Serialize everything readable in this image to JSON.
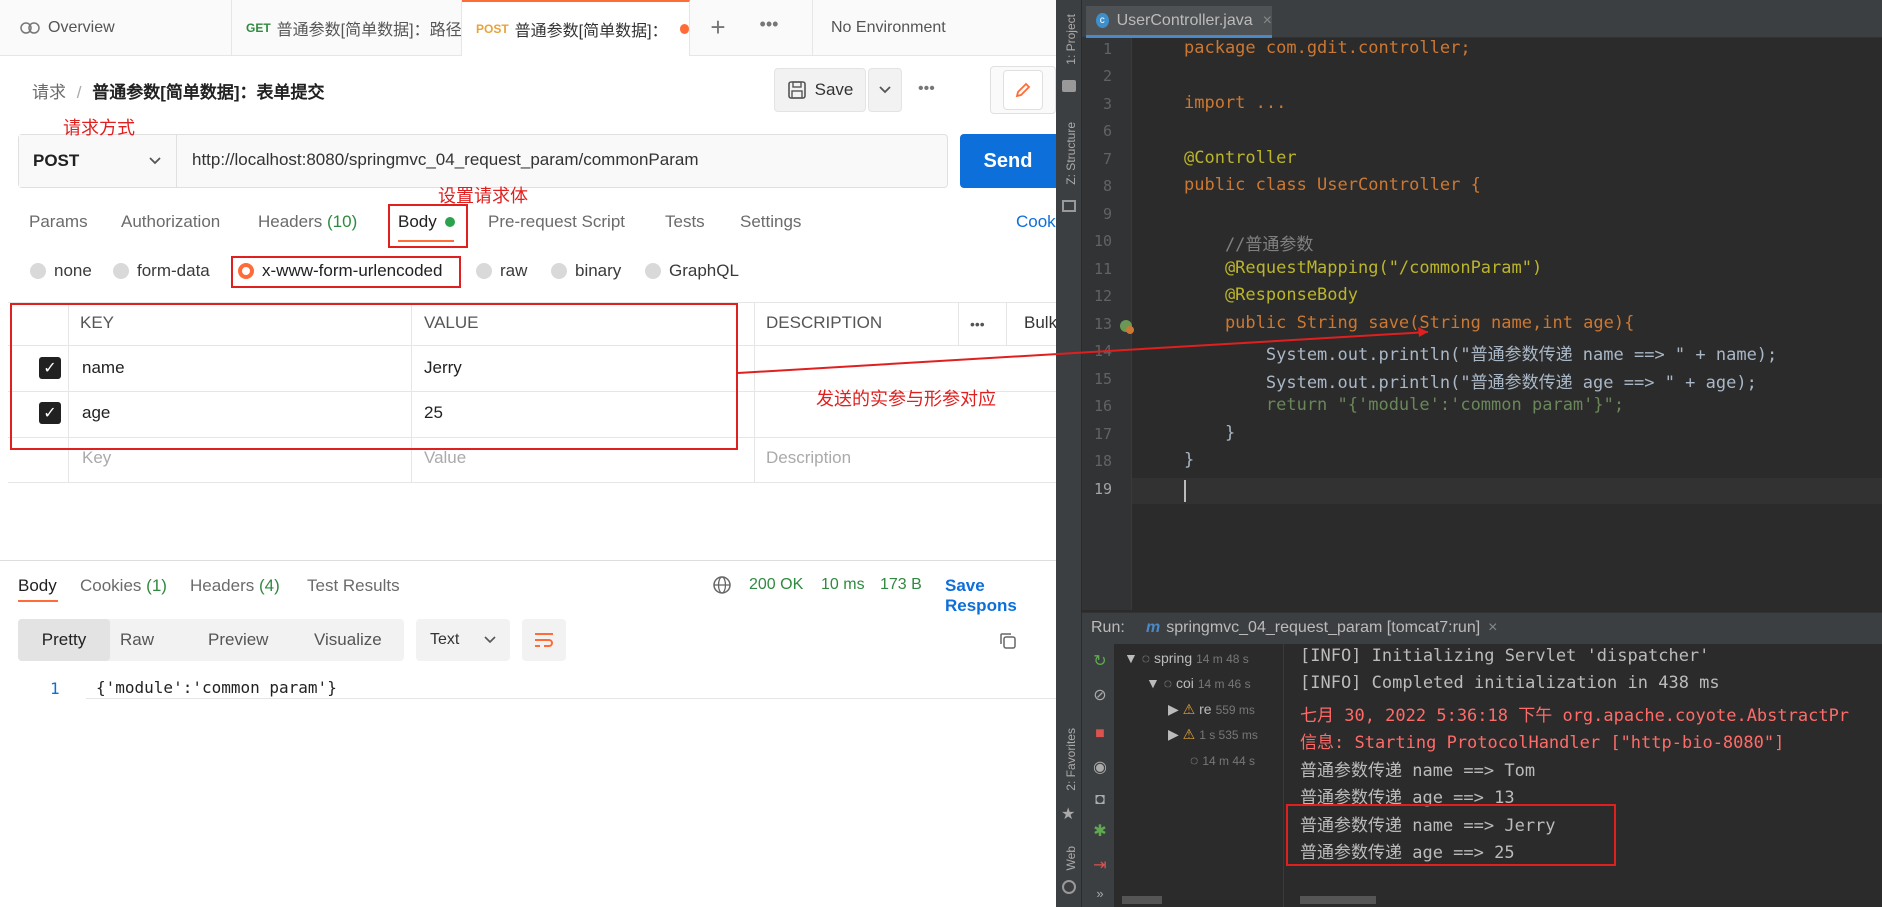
{
  "postman": {
    "tabs": [
      {
        "label": "Overview",
        "method": ""
      },
      {
        "label": "普通参数[简单数据]：路径",
        "method": "GET"
      },
      {
        "label": "普通参数[简单数据]：",
        "method": "POST"
      }
    ],
    "environment": "No Environment",
    "breadcrumb": {
      "root": "请求",
      "sep": "/",
      "name": "普通参数[简单数据]：表单提交"
    },
    "save_label": "Save",
    "method": "POST",
    "url": "http://localhost:8080/springmvc_04_request_param/commonParam",
    "send_label": "Send",
    "req_tabs": [
      "Params",
      "Authorization",
      "Headers",
      "Body",
      "Pre-request Script",
      "Tests",
      "Settings"
    ],
    "headers_count": "(10)",
    "cookies_link": "Cook",
    "body_types": [
      "none",
      "form-data",
      "x-www-form-urlencoded",
      "raw",
      "binary",
      "GraphQL"
    ],
    "table_headers": {
      "key": "KEY",
      "value": "VALUE",
      "description": "DESCRIPTION",
      "bulk": "Bulk"
    },
    "rows": [
      {
        "key": "name",
        "value": "Jerry"
      },
      {
        "key": "age",
        "value": "25"
      }
    ],
    "placeholders": {
      "key": "Key",
      "value": "Value",
      "description": "Description"
    },
    "resp_tabs": {
      "body": "Body",
      "cookies": "Cookies",
      "cookies_count": "(1)",
      "headers": "Headers",
      "headers_count": "(4)",
      "tests": "Test Results"
    },
    "status": "200 OK",
    "time": "10 ms",
    "size": "173 B",
    "save_response": "Save Respons",
    "view_modes": [
      "Pretty",
      "Raw",
      "Preview",
      "Visualize"
    ],
    "format": "Text",
    "response_line": "1",
    "response_body": "{'module':'common param'}"
  },
  "annotations": {
    "method": "请求方式",
    "body": "设置请求体",
    "params": "发送的实参与形参对应"
  },
  "ide": {
    "file_tab": "UserController.java",
    "side_labels": {
      "project": "1: Project",
      "structure": "Z: Structure",
      "favorites": "2: Favorites",
      "web": "Web"
    },
    "code_lines": [
      {
        "n": "1",
        "text": "package com.gdit.controller;"
      },
      {
        "n": "2",
        "text": ""
      },
      {
        "n": "3",
        "text": "import ..."
      },
      {
        "n": "6",
        "text": ""
      },
      {
        "n": "7",
        "text": "@Controller"
      },
      {
        "n": "8",
        "text": "public class UserController {"
      },
      {
        "n": "9",
        "text": ""
      },
      {
        "n": "10",
        "text": "    //普通参数"
      },
      {
        "n": "11",
        "text": "    @RequestMapping(\"/commonParam\")"
      },
      {
        "n": "12",
        "text": "    @ResponseBody"
      },
      {
        "n": "13",
        "text": "    public String save(String name,int age){"
      },
      {
        "n": "14",
        "text": "        System.out.println(\"普通参数传递 name ==> \" + name);"
      },
      {
        "n": "15",
        "text": "        System.out.println(\"普通参数传递 age ==> \" + age);"
      },
      {
        "n": "16",
        "text": "        return \"{'module':'common param'}\";"
      },
      {
        "n": "17",
        "text": "    }"
      },
      {
        "n": "18",
        "text": "}"
      },
      {
        "n": "19",
        "text": ""
      }
    ],
    "run_label": "Run:",
    "run_config": "springmvc_04_request_param [tomcat7:run]",
    "tree": [
      {
        "label": "spring",
        "time": "14 m 48 s"
      },
      {
        "label": "coi",
        "time": "14 m 46 s"
      },
      {
        "label": "re",
        "time": "559 ms"
      },
      {
        "label": "",
        "time": "1 s 535 ms"
      },
      {
        "label": "",
        "time": "14 m 44 s"
      }
    ],
    "console": [
      "[INFO] Initializing Servlet 'dispatcher'",
      "[INFO] Completed initialization in 438 ms",
      "七月 30, 2022 5:36:18 下午 org.apache.coyote.AbstractPr",
      "信息: Starting ProtocolHandler [\"http-bio-8080\"]",
      "普通参数传递 name ==> Tom",
      "普通参数传递 age ==> 13",
      "普通参数传递 name ==> Jerry",
      "普通参数传递 age ==> 25"
    ]
  }
}
